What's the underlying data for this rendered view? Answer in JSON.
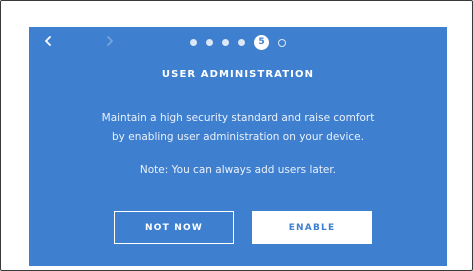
{
  "wizard": {
    "current_step": "5",
    "total_steps": 6,
    "title": "USER ADMINISTRATION",
    "description_line1": "Maintain a high security standard and raise comfort",
    "description_line2": "by enabling user administration on your device.",
    "note": "Note: You can always add users later.",
    "secondary_button": "NOT NOW",
    "primary_button": "ENABLE"
  },
  "icons": {
    "back": "chevron-left-icon",
    "forward": "chevron-right-icon"
  },
  "colors": {
    "background": "#3f7fd0",
    "foreground": "#ffffff",
    "dot_inactive": "#dbe6f6"
  }
}
